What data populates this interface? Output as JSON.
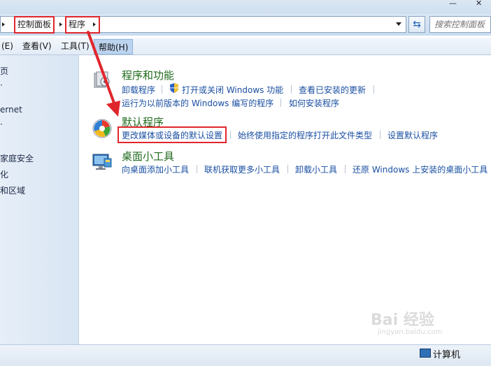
{
  "address_bar": {
    "crumbs": [
      "控制面板",
      "程序"
    ],
    "search_placeholder": "搜索控制面板"
  },
  "menu": {
    "items": [
      "(E)",
      "查看(V)",
      "工具(T)",
      "帮助(H)"
    ]
  },
  "left_nav": {
    "items": [
      "页",
      "ernet",
      "家庭安全",
      "化",
      "和区域"
    ]
  },
  "categories": [
    {
      "title": "程序和功能",
      "links": [
        "卸载程序",
        "打开或关闭 Windows 功能",
        "查看已安装的更新",
        "运行为以前版本的 Windows 编写的程序",
        "如何安装程序"
      ]
    },
    {
      "title": "默认程序",
      "links": [
        "更改媒体或设备的默认设置",
        "始终使用指定的程序打开此文件类型",
        "设置默认程序"
      ]
    },
    {
      "title": "桌面小工具",
      "links": [
        "向桌面添加小工具",
        "联机获取更多小工具",
        "卸载小工具",
        "还原 Windows 上安装的桌面小工具"
      ]
    }
  ],
  "status_bar": {
    "computer_label": "计算机"
  },
  "watermark": {
    "text": "Bai 经验",
    "sub": "jingyan.baidu.com"
  },
  "icons": {
    "shield": "uac-shield-icon",
    "programs": "programs-features-icon",
    "default": "default-programs-icon",
    "gadgets": "desktop-gadgets-icon"
  },
  "colors": {
    "link": "#1a4fa2",
    "category_title": "#1f6a1b",
    "annotation_red": "#e0262c"
  }
}
